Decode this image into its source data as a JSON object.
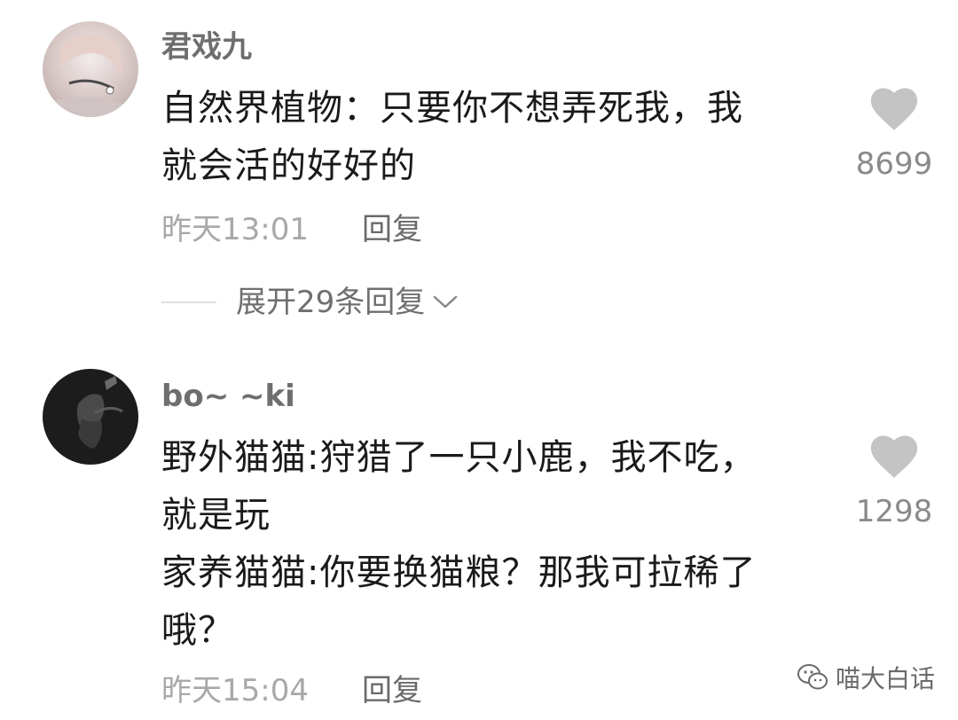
{
  "comments": [
    {
      "username": "君戏九",
      "content_lines": [
        "自然界植物：只要你不想弄死我，我",
        "就会活的好好的"
      ],
      "timestamp": "昨天13:01",
      "reply_label": "回复",
      "like_count": "8699",
      "expand_replies_label": "展开29条回复"
    },
    {
      "username": "bo~ ~ki",
      "content_lines": [
        "野外猫猫:狩猎了一只小鹿，我不吃，",
        "就是玩",
        "家养猫猫:你要换猫粮？那我可拉稀了",
        "哦？"
      ],
      "timestamp": "昨天15:04",
      "reply_label": "回复",
      "like_count": "1298"
    }
  ],
  "watermark": {
    "text": "喵大白话",
    "icon": "wechat-icon"
  },
  "icons": {
    "like": "heart-icon",
    "expand": "chevron-down-icon"
  },
  "colors": {
    "username": "#6e6e6e",
    "content": "#1a1a1a",
    "meta": "#a8a8a8",
    "heart": "#c4c4c4"
  }
}
